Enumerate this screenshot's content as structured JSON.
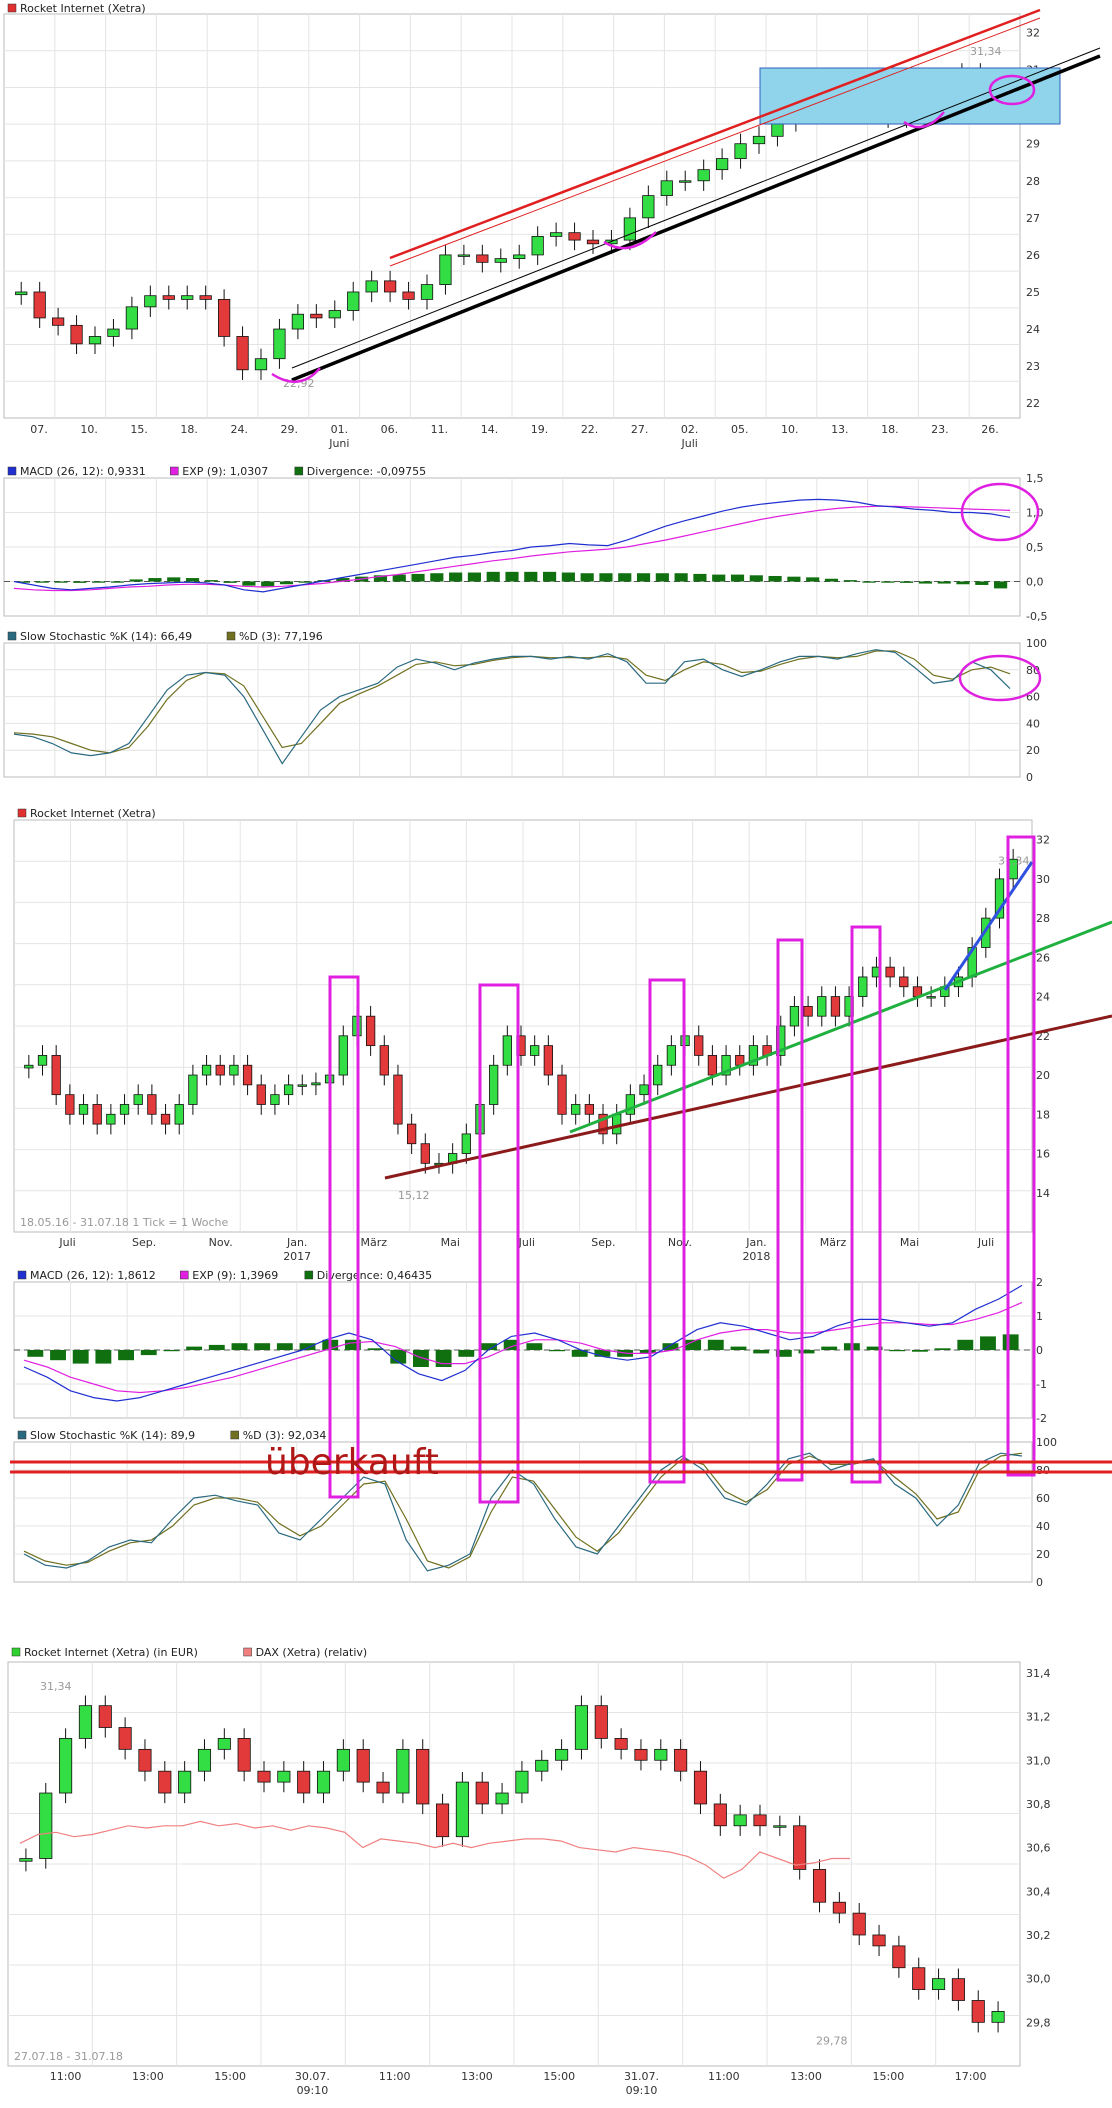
{
  "charts": [
    {
      "id": "c1",
      "legend": [
        {
          "label": "Rocket Internet (Xetra)",
          "color": "#e03030"
        }
      ],
      "y_ticks": [
        "32",
        "31",
        "30",
        "29",
        "28",
        "27",
        "26",
        "25",
        "24",
        "23",
        "22"
      ],
      "x_ticks": [
        "07.",
        "10.",
        "15.",
        "18.",
        "24.",
        "29.",
        "01.",
        "06.",
        "11.",
        "14.",
        "19.",
        "22.",
        "27.",
        "02.",
        "05.",
        "10.",
        "13.",
        "18.",
        "23.",
        "26."
      ],
      "x_subticks": [
        "Juni",
        "Juli"
      ],
      "annotations": [
        "31,34",
        "22,92"
      ]
    },
    {
      "id": "c1_macd",
      "legend": [
        {
          "label": "MACD (26, 12): 0,9331",
          "color": "#2030d0"
        },
        {
          "label": "EXP (9): 1,0307",
          "color": "#e020e0"
        },
        {
          "label": "Divergence: -0,09755",
          "color": "#107010"
        }
      ],
      "y_ticks": [
        "1,5",
        "1,0",
        "0,5",
        "0,0",
        "-0,5"
      ]
    },
    {
      "id": "c1_stoch",
      "legend": [
        {
          "label": "Slow Stochastic %K (14): 66,49",
          "color": "#2a6a80"
        },
        {
          "label": "%D (3): 77,196",
          "color": "#707020"
        }
      ],
      "y_ticks": [
        "100",
        "80",
        "60",
        "40",
        "20",
        "0"
      ]
    },
    {
      "id": "c2",
      "legend": [
        {
          "label": "Rocket Internet (Xetra)",
          "color": "#e03030"
        }
      ],
      "y_ticks": [
        "32",
        "30",
        "28",
        "26",
        "24",
        "22",
        "20",
        "18",
        "16",
        "14"
      ],
      "x_ticks": [
        "Juli",
        "Sep.",
        "Nov.",
        "Jan.",
        "März",
        "Mai",
        "Juli",
        "Sep.",
        "Nov.",
        "Jan.",
        "März",
        "Mai",
        "Juli"
      ],
      "x_subticks": [
        "2017",
        "2018"
      ],
      "footer": [
        "18.05.16 - 31.07.18",
        "1 Tick = 1 Woche"
      ],
      "annotations": [
        "31,34",
        "15,12"
      ]
    },
    {
      "id": "c2_macd",
      "legend": [
        {
          "label": "MACD (26, 12): 1,8612",
          "color": "#2030d0"
        },
        {
          "label": "EXP (9): 1,3969",
          "color": "#e020e0"
        },
        {
          "label": "Divergence: 0,46435",
          "color": "#107010"
        }
      ],
      "y_ticks": [
        "2",
        "1",
        "0",
        "-1",
        "-2"
      ]
    },
    {
      "id": "c2_stoch",
      "legend": [
        {
          "label": "Slow Stochastic %K (14): 89,9",
          "color": "#2a6a80"
        },
        {
          "label": "%D (3): 92,034",
          "color": "#707020"
        }
      ],
      "y_ticks": [
        "100",
        "80",
        "60",
        "40",
        "20",
        "0"
      ],
      "annotation": "überkauft"
    },
    {
      "id": "c3",
      "legend": [
        {
          "label": "Rocket Internet (Xetra) (in EUR)",
          "color": "#30d030"
        },
        {
          "label": "DAX (Xetra) (relativ)",
          "color": "#f08080"
        }
      ],
      "y_ticks": [
        "31,4",
        "31,2",
        "31,0",
        "30,8",
        "30,6",
        "30,4",
        "30,2",
        "30,0",
        "29,8"
      ],
      "x_ticks": [
        "11:00",
        "13:00",
        "15:00",
        "30.07.",
        "11:00",
        "13:00",
        "15:00",
        "31.07.",
        "11:00",
        "13:00",
        "15:00",
        "17:00"
      ],
      "x_subticks": [
        "09:10",
        "09:10"
      ],
      "footer": [
        "27.07.18 - 31.07.18"
      ],
      "annotations": [
        "31,34",
        "29,78"
      ]
    }
  ],
  "chart_data": [
    {
      "type": "candlestick",
      "title": "Rocket Internet (Xetra)",
      "period": "daily, Juni - Juli 2018",
      "ylim": [
        21.6,
        32.5
      ],
      "annotations": {
        "high": 31.34,
        "low": 22.92
      },
      "close_series": [
        25.0,
        24.3,
        24.1,
        23.6,
        23.8,
        24.0,
        24.6,
        24.9,
        24.8,
        24.9,
        24.8,
        23.8,
        22.9,
        23.2,
        24.0,
        24.4,
        24.3,
        24.5,
        25.0,
        25.3,
        25.0,
        24.8,
        25.2,
        26.0,
        26.0,
        25.8,
        25.9,
        26.0,
        26.5,
        26.6,
        26.4,
        26.3,
        26.4,
        27.0,
        27.6,
        28.0,
        28.0,
        28.3,
        28.6,
        29.0,
        29.2,
        29.6,
        29.8,
        30.0,
        30.4,
        30.1,
        30.0,
        29.7,
        29.8,
        30.4,
        30.6,
        30.9,
        30.7,
        30.1
      ]
    },
    {
      "type": "line",
      "title": "MACD (26, 12)",
      "ylim": [
        -0.5,
        1.5
      ],
      "series": [
        {
          "name": "MACD (26, 12)",
          "values": [
            0.0,
            -0.05,
            -0.1,
            -0.12,
            -0.1,
            -0.08,
            -0.05,
            -0.03,
            -0.02,
            -0.01,
            -0.02,
            -0.05,
            -0.12,
            -0.15,
            -0.1,
            -0.05,
            0.0,
            0.05,
            0.1,
            0.15,
            0.2,
            0.25,
            0.3,
            0.35,
            0.38,
            0.42,
            0.45,
            0.5,
            0.52,
            0.55,
            0.53,
            0.52,
            0.6,
            0.7,
            0.8,
            0.88,
            0.95,
            1.02,
            1.08,
            1.12,
            1.15,
            1.18,
            1.19,
            1.18,
            1.15,
            1.1,
            1.08,
            1.05,
            1.03,
            1.0,
            1.0,
            0.98,
            0.93
          ]
        },
        {
          "name": "EXP (9)",
          "values": [
            -0.1,
            -0.12,
            -0.13,
            -0.13,
            -0.12,
            -0.1,
            -0.08,
            -0.07,
            -0.05,
            -0.04,
            -0.04,
            -0.05,
            -0.07,
            -0.08,
            -0.07,
            -0.05,
            -0.03,
            0.0,
            0.03,
            0.07,
            0.1,
            0.14,
            0.18,
            0.22,
            0.26,
            0.3,
            0.33,
            0.37,
            0.4,
            0.43,
            0.45,
            0.47,
            0.5,
            0.55,
            0.6,
            0.66,
            0.72,
            0.78,
            0.84,
            0.9,
            0.95,
            0.99,
            1.03,
            1.06,
            1.08,
            1.09,
            1.09,
            1.08,
            1.07,
            1.06,
            1.05,
            1.04,
            1.03
          ]
        },
        {
          "name": "Divergence",
          "values": [
            0.0,
            0.0,
            -0.01,
            -0.02,
            -0.01,
            0.0,
            0.03,
            0.05,
            0.06,
            0.05,
            0.02,
            -0.02,
            -0.06,
            -0.07,
            -0.04,
            -0.01,
            0.02,
            0.05,
            0.07,
            0.09,
            0.1,
            0.11,
            0.12,
            0.13,
            0.13,
            0.14,
            0.14,
            0.14,
            0.14,
            0.13,
            0.12,
            0.12,
            0.12,
            0.12,
            0.12,
            0.12,
            0.11,
            0.1,
            0.1,
            0.09,
            0.08,
            0.07,
            0.06,
            0.04,
            0.02,
            0.0,
            -0.01,
            -0.02,
            -0.03,
            -0.03,
            -0.04,
            -0.05,
            -0.1
          ]
        }
      ]
    },
    {
      "type": "line",
      "title": "Slow Stochastic %K (14)",
      "ylim": [
        0,
        100
      ],
      "series": [
        {
          "name": "Slow Stochastic %K (14)",
          "values": [
            32,
            30,
            25,
            18,
            16,
            18,
            25,
            45,
            65,
            76,
            78,
            76,
            60,
            35,
            10,
            30,
            50,
            60,
            65,
            70,
            82,
            88,
            85,
            80,
            85,
            88,
            90,
            90,
            88,
            90,
            88,
            92,
            86,
            70,
            70,
            86,
            88,
            80,
            75,
            80,
            86,
            90,
            90,
            88,
            92,
            95,
            93,
            82,
            70,
            72,
            86,
            80,
            66
          ]
        },
        {
          "name": "%D (3)",
          "values": [
            33,
            32,
            30,
            25,
            20,
            18,
            22,
            38,
            58,
            72,
            78,
            77,
            68,
            45,
            22,
            25,
            40,
            55,
            62,
            68,
            76,
            84,
            86,
            83,
            84,
            87,
            89,
            90,
            89,
            89,
            89,
            90,
            88,
            76,
            72,
            80,
            86,
            84,
            78,
            79,
            84,
            88,
            90,
            89,
            90,
            94,
            94,
            88,
            76,
            73,
            80,
            82,
            77
          ]
        }
      ]
    },
    {
      "type": "candlestick",
      "title": "Rocket Internet (Xetra)",
      "period": "weekly, 18.05.16 - 31.07.18",
      "ylim": [
        12.0,
        33.0
      ],
      "annotations": {
        "high": 31.34,
        "low": 15.12
      },
      "close_series": [
        20.5,
        21.0,
        19.0,
        18.0,
        18.5,
        17.5,
        18.0,
        18.5,
        19.0,
        18.0,
        17.5,
        18.5,
        20.0,
        20.5,
        20.0,
        20.5,
        19.5,
        18.5,
        19.0,
        19.5,
        19.5,
        19.6,
        20.0,
        22.0,
        23.0,
        21.5,
        20.0,
        17.5,
        16.5,
        15.5,
        15.5,
        16.0,
        17.0,
        18.5,
        20.5,
        22.0,
        21.0,
        21.5,
        20.0,
        18.0,
        18.5,
        18.0,
        17.0,
        18.0,
        19.0,
        19.5,
        20.5,
        21.5,
        22.0,
        21.0,
        20.0,
        21.0,
        20.5,
        21.5,
        21.0,
        22.5,
        23.5,
        23.0,
        24.0,
        23.0,
        24.0,
        25.0,
        25.5,
        25.0,
        24.5,
        24.0,
        24.0,
        24.5,
        25.0,
        26.5,
        28.0,
        30.0,
        31.0
      ]
    },
    {
      "type": "line",
      "title": "MACD (26, 12)",
      "ylim": [
        -2,
        2
      ],
      "series": [
        {
          "name": "MACD (26, 12)",
          "values": [
            -0.5,
            -0.8,
            -1.2,
            -1.4,
            -1.5,
            -1.4,
            -1.2,
            -1.0,
            -0.8,
            -0.6,
            -0.4,
            -0.2,
            0.0,
            0.3,
            0.5,
            0.3,
            -0.3,
            -0.7,
            -0.9,
            -0.6,
            0.0,
            0.4,
            0.5,
            0.3,
            0.0,
            -0.2,
            -0.3,
            -0.2,
            0.2,
            0.6,
            0.8,
            0.7,
            0.5,
            0.3,
            0.4,
            0.7,
            0.9,
            0.9,
            0.8,
            0.7,
            0.8,
            1.2,
            1.5,
            1.9
          ]
        },
        {
          "name": "EXP (9)",
          "values": [
            -0.3,
            -0.5,
            -0.8,
            -1.0,
            -1.2,
            -1.25,
            -1.2,
            -1.1,
            -0.95,
            -0.8,
            -0.6,
            -0.4,
            -0.2,
            0.0,
            0.2,
            0.25,
            0.1,
            -0.2,
            -0.4,
            -0.4,
            -0.2,
            0.1,
            0.3,
            0.3,
            0.2,
            0.0,
            -0.1,
            -0.1,
            0.0,
            0.3,
            0.5,
            0.6,
            0.6,
            0.5,
            0.5,
            0.6,
            0.7,
            0.8,
            0.8,
            0.75,
            0.75,
            0.9,
            1.1,
            1.4
          ]
        },
        {
          "name": "Divergence",
          "values": [
            -0.2,
            -0.3,
            -0.4,
            -0.4,
            -0.3,
            -0.15,
            0.0,
            0.1,
            0.15,
            0.2,
            0.2,
            0.2,
            0.2,
            0.3,
            0.3,
            0.05,
            -0.4,
            -0.5,
            -0.5,
            -0.2,
            0.2,
            0.3,
            0.2,
            0.0,
            -0.2,
            -0.2,
            -0.2,
            -0.1,
            0.2,
            0.3,
            0.3,
            0.1,
            -0.1,
            -0.2,
            -0.1,
            0.1,
            0.2,
            0.1,
            0.0,
            -0.05,
            0.05,
            0.3,
            0.4,
            0.46
          ]
        }
      ]
    },
    {
      "type": "line",
      "title": "Slow Stochastic %K (14)",
      "ylim": [
        0,
        100
      ],
      "series": [
        {
          "name": "Slow Stochastic %K (14)",
          "values": [
            20,
            12,
            10,
            15,
            25,
            30,
            28,
            45,
            60,
            62,
            58,
            55,
            35,
            30,
            45,
            60,
            75,
            70,
            30,
            8,
            12,
            20,
            60,
            80,
            70,
            45,
            25,
            20,
            40,
            60,
            80,
            90,
            80,
            60,
            55,
            70,
            88,
            92,
            80,
            85,
            88,
            70,
            60,
            40,
            55,
            85,
            92,
            90
          ]
        },
        {
          "name": "%D (3)",
          "values": [
            22,
            15,
            12,
            14,
            22,
            28,
            30,
            40,
            55,
            60,
            60,
            57,
            42,
            33,
            40,
            55,
            70,
            72,
            45,
            15,
            10,
            18,
            50,
            75,
            72,
            52,
            32,
            22,
            35,
            55,
            75,
            88,
            84,
            65,
            57,
            66,
            84,
            90,
            84,
            84,
            87,
            75,
            63,
            45,
            50,
            80,
            90,
            92
          ]
        }
      ]
    },
    {
      "type": "candlestick",
      "title": "Rocket Internet (Xetra) (in EUR)",
      "period": "intraday, 27.07.18 - 31.07.18",
      "ylim": [
        29.6,
        31.45
      ],
      "annotations": {
        "high": 31.34,
        "low": 29.78
      },
      "close_series": [
        30.55,
        30.85,
        31.1,
        31.25,
        31.15,
        31.05,
        30.95,
        30.85,
        30.95,
        31.05,
        31.1,
        30.95,
        30.9,
        30.95,
        30.85,
        30.95,
        31.05,
        30.9,
        30.85,
        31.05,
        30.8,
        30.65,
        30.9,
        30.8,
        30.85,
        30.95,
        31.0,
        31.05,
        31.25,
        31.1,
        31.05,
        31.0,
        31.05,
        30.95,
        30.8,
        30.7,
        30.75,
        30.7,
        30.7,
        30.5,
        30.35,
        30.3,
        30.2,
        30.15,
        30.05,
        29.95,
        30.0,
        29.9,
        29.8,
        29.85
      ]
    }
  ]
}
